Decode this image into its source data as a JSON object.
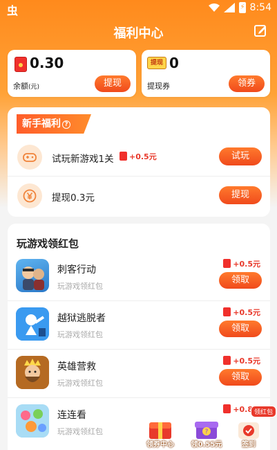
{
  "status_bar": {
    "app_glyph": "虫",
    "time": "8:54",
    "battery_glyph": "⚡"
  },
  "header": {
    "title": "福利中心"
  },
  "balance": {
    "value": "0.30",
    "label": "余额",
    "label_unit": "(元)",
    "button": "提现"
  },
  "coupon": {
    "icon_text": "提现",
    "value": "0",
    "label": "提现券",
    "button": "领券"
  },
  "newbie": {
    "title": "新手福利",
    "help_glyph": "?",
    "tasks": [
      {
        "text": "试玩新游戏1关",
        "reward": "+0.5元",
        "button": "试玩"
      },
      {
        "text": "提现0.3元",
        "reward": "",
        "button": "提现"
      }
    ]
  },
  "games": {
    "title": "玩游戏领红包",
    "items": [
      {
        "name": "刺客行动",
        "subtitle": "玩游戏领红包",
        "reward": "+0.5元",
        "button": "领取"
      },
      {
        "name": "越狱逃脱者",
        "subtitle": "玩游戏领红包",
        "reward": "+0.5元",
        "button": "领取"
      },
      {
        "name": "英雄营救",
        "subtitle": "玩游戏领红包",
        "reward": "+0.5元",
        "button": "领取"
      },
      {
        "name": "连连看",
        "subtitle": "玩游戏领红包",
        "reward": "+0.8元",
        "button": "领取"
      }
    ]
  },
  "floating": {
    "coupon_center": "领券中心",
    "mystery": "领0.55元",
    "checkin": "签到",
    "hongbao_badge": "领红包"
  },
  "colors": {
    "accent": "#ff7a2d",
    "accent_dark": "#f04a1c",
    "reward_red": "#e8392b"
  }
}
